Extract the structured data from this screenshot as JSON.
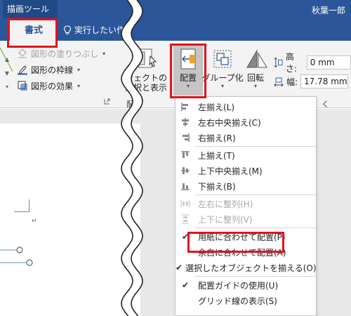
{
  "titlebar": {
    "context_tab": "描画ツール",
    "user_name": "秋葉一郎",
    "tab_format": "書式",
    "tellme": "実行したい作"
  },
  "ribbon": {
    "shape_fill": "図形の塗りつぶし",
    "shape_outline": "図形の枠線",
    "shape_effects": "図形の効果",
    "selection_line1": "ジェクトの",
    "selection_line2": "選択と表示",
    "arrange": "配置",
    "group": "グループ化",
    "rotate": "回転",
    "group_label_arrange": "配置",
    "group_label_size": "く",
    "height_label": "高さ:",
    "height_value": "0 mm",
    "width_label": "幅:",
    "width_value": "17.78 mm"
  },
  "menu": {
    "items": [
      {
        "label": "左揃え(L)",
        "icon": "align-left-icon",
        "disabled": false,
        "checked": false
      },
      {
        "label": "左右中央揃え(C)",
        "icon": "align-center-icon",
        "disabled": false,
        "checked": false
      },
      {
        "label": "右揃え(R)",
        "icon": "align-right-icon",
        "disabled": false,
        "checked": false
      },
      {
        "label": "上揃え(T)",
        "icon": "align-top-icon",
        "disabled": false,
        "checked": false
      },
      {
        "label": "上下中央揃え(M)",
        "icon": "align-middle-icon",
        "disabled": false,
        "checked": false
      },
      {
        "label": "下揃え(B)",
        "icon": "align-bottom-icon",
        "disabled": false,
        "checked": false
      },
      {
        "label": "左右に整列(H)",
        "icon": "distribute-horizontal-icon",
        "disabled": true,
        "checked": false
      },
      {
        "label": "上下に整列(V)",
        "icon": "distribute-vertical-icon",
        "disabled": true,
        "checked": false
      },
      {
        "label": "用紙に合わせて配置(P)",
        "icon": "",
        "disabled": false,
        "checked": true
      },
      {
        "label": "余白に合わせて配置(A)",
        "icon": "",
        "disabled": false,
        "checked": false
      },
      {
        "label": "選択したオブジェクトを揃える(O)",
        "icon": "",
        "disabled": false,
        "checked": true
      },
      {
        "label": "配置ガイドの使用(U)",
        "icon": "",
        "disabled": false,
        "checked": true
      },
      {
        "label": "グリッド線の表示(S)",
        "icon": "",
        "disabled": false,
        "checked": false
      }
    ]
  },
  "colors": {
    "title_blue": "#2b579a",
    "highlight_red": "#e0141e",
    "ribbon_bg": "#f3f3f3"
  }
}
